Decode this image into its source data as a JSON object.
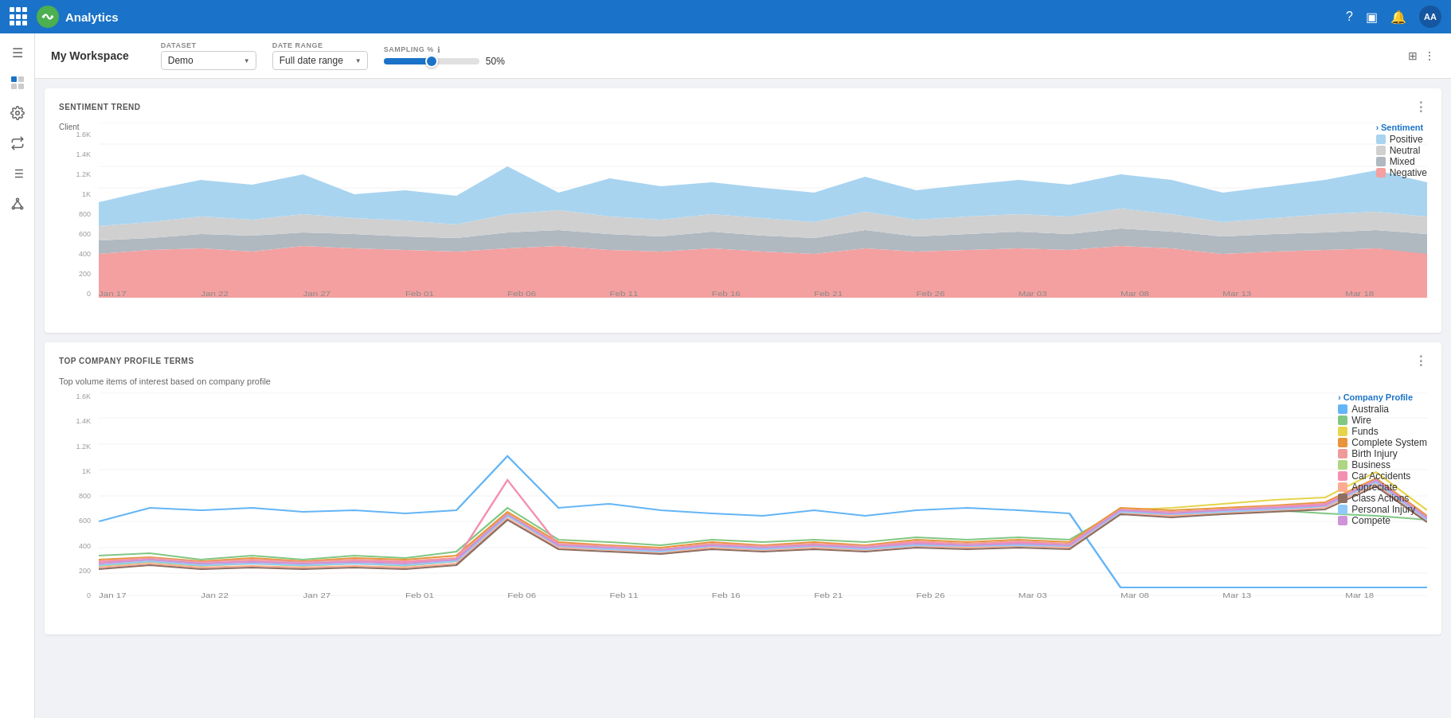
{
  "nav": {
    "title": "Analytics",
    "avatar": "AA",
    "icons": [
      "?",
      "■",
      "🔔"
    ]
  },
  "toolbar": {
    "title": "My Workspace",
    "dataset_label": "DATASET",
    "dataset_value": "Demo",
    "daterange_label": "DATE RANGE",
    "daterange_value": "Full date range",
    "sampling_label": "SAMPLING %",
    "sampling_pct": "50%",
    "sampling_value": 50
  },
  "sentiment_panel": {
    "title": "SENTIMENT TREND",
    "y_label": "Client",
    "y_ticks": [
      "1.6K",
      "1.4K",
      "1.2K",
      "1K",
      "800",
      "600",
      "400",
      "200",
      "0"
    ],
    "x_ticks": [
      "Jan 17",
      "Jan 22",
      "Jan 27",
      "Feb 01",
      "Feb 06",
      "Feb 11",
      "Feb 16",
      "Feb 21",
      "Feb 26",
      "Mar 03",
      "Mar 08",
      "Mar 13",
      "Mar 18"
    ],
    "legend_section": "Sentiment",
    "legend_items": [
      {
        "label": "Positive",
        "color": "#a8d4f0"
      },
      {
        "label": "Neutral",
        "color": "#d0d0d0"
      },
      {
        "label": "Mixed",
        "color": "#b0b8c0"
      },
      {
        "label": "Negative",
        "color": "#f4a0a0"
      }
    ]
  },
  "company_panel": {
    "title": "TOP COMPANY PROFILE TERMS",
    "subtitle": "Top volume items of interest based on company profile",
    "y_ticks": [
      "1.6K",
      "1.4K",
      "1.2K",
      "1K",
      "800",
      "600",
      "400",
      "200",
      "0"
    ],
    "x_ticks": [
      "Jan 17",
      "Jan 22",
      "Jan 27",
      "Feb 01",
      "Feb 06",
      "Feb 11",
      "Feb 16",
      "Feb 21",
      "Feb 26",
      "Mar 03",
      "Mar 08",
      "Mar 13",
      "Mar 18"
    ],
    "legend_section": "Company Profile",
    "legend_items": [
      {
        "label": "Australia",
        "color": "#64b5f6"
      },
      {
        "label": "Wire",
        "color": "#81c784"
      },
      {
        "label": "Funds",
        "color": "#e6d44a"
      },
      {
        "label": "Complete System",
        "color": "#e8943a"
      },
      {
        "label": "Birth Injury",
        "color": "#ef9a9a"
      },
      {
        "label": "Business",
        "color": "#aed581"
      },
      {
        "label": "Car Accidents",
        "color": "#f48fb1"
      },
      {
        "label": "Appreciate",
        "color": "#ffab91"
      },
      {
        "label": "Class Actions",
        "color": "#8d6e63"
      },
      {
        "label": "Personal Injury",
        "color": "#90caf9"
      },
      {
        "label": "Compete",
        "color": "#ce93d8"
      }
    ]
  },
  "sidebar_icons": [
    {
      "name": "menu-icon",
      "symbol": "☰"
    },
    {
      "name": "grid-icon",
      "symbol": "⊞"
    },
    {
      "name": "settings-icon",
      "symbol": "⚙"
    },
    {
      "name": "filter-icon",
      "symbol": "⇄"
    },
    {
      "name": "list-icon",
      "symbol": "☰"
    },
    {
      "name": "share-icon",
      "symbol": "⛓"
    }
  ]
}
